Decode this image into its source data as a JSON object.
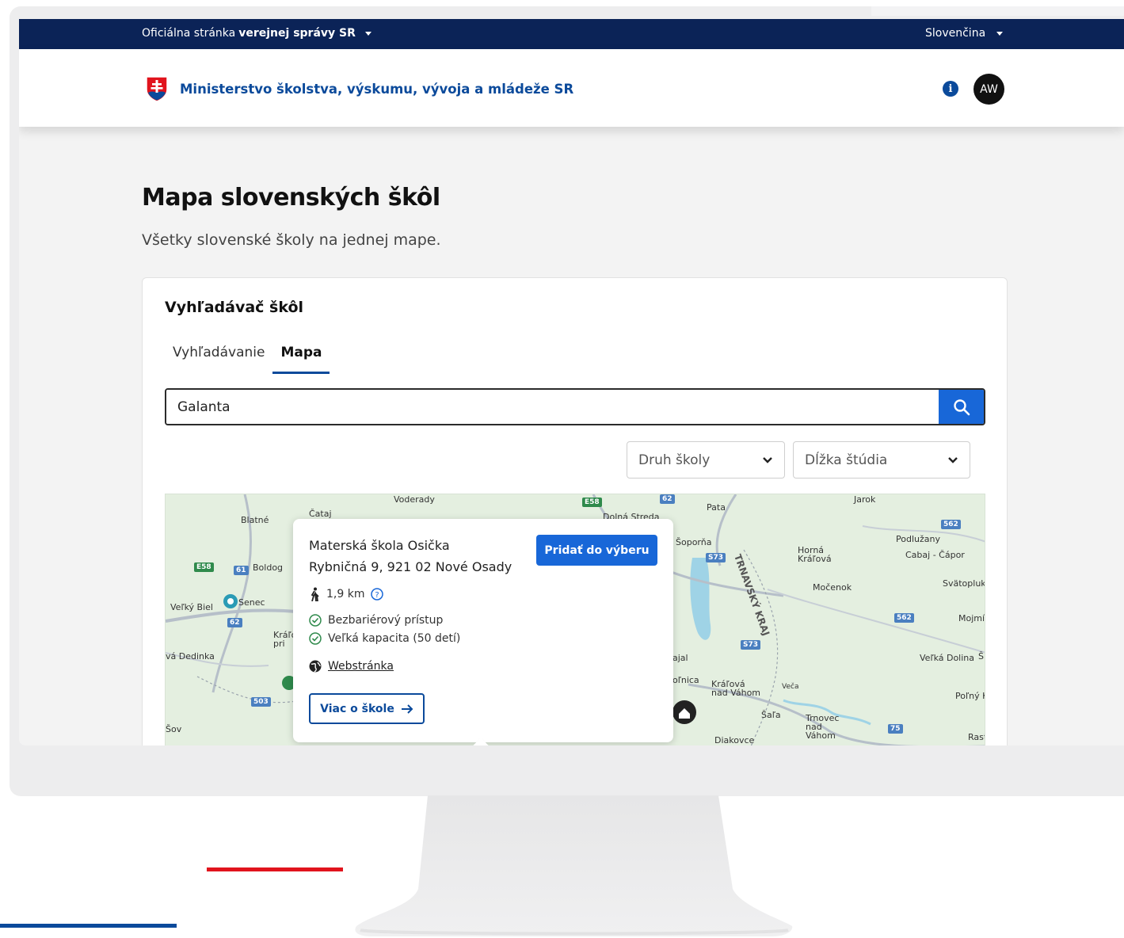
{
  "gov_bar": {
    "official_prefix": "Oficiálna stránka",
    "official_bold": "verejnej správy SR",
    "language": "Slovenčina"
  },
  "header": {
    "ministry": "Ministerstvo školstva, výskumu, vývoja a mládeže SR",
    "avatar_initials": "AW"
  },
  "page": {
    "title": "Mapa slovenských škôl",
    "subtitle": "Všetky slovenské školy na jednej mape."
  },
  "search_card": {
    "title": "Vyhľadávač škôl",
    "tabs": [
      {
        "label": "Vyhľadávanie",
        "active": false
      },
      {
        "label": "Mapa",
        "active": true
      }
    ],
    "search_value": "Galanta",
    "filters": [
      {
        "label": "Druh školy"
      },
      {
        "label": "Dĺžka štúdia"
      }
    ]
  },
  "map": {
    "labels": [
      "Voderady",
      "Čataj",
      "Blatné",
      "Dolná Streda",
      "Pata",
      "Jarok",
      "Boldog",
      "Podlužany",
      "Cabaj - Čápor",
      "Horná Kráľová",
      "Močenok",
      "Svätopluk",
      "Veľký Biel",
      "Senec",
      "Kráľová pri Senci",
      "Mojmír",
      "vá Dedinka",
      "Veľká Dolina",
      "Šoporňa",
      "Kráľová nad Váhom",
      "Veča",
      "Šaľa",
      "Trnovec nad Váhom",
      "Diakovce",
      "Poľný K",
      "Šov",
      "ajal",
      "oľnica",
      "TRNAVSKÝ KRAJ",
      "Rast",
      "Š"
    ],
    "road_numbers": [
      "E58",
      "61",
      "62",
      "503",
      "E58",
      "62",
      "S73",
      "S73",
      "562",
      "562",
      "75"
    ]
  },
  "popup": {
    "name": "Materská škola Osička",
    "address": "Rybničná 9, 921 02 Nové Osady",
    "add_button": "Pridať do výberu",
    "distance": "1,9 km",
    "features": [
      "Bezbariérový prístup",
      "Veľká kapacita (50 detí)"
    ],
    "website": "Webstránka",
    "more_button": "Viac o škole"
  },
  "colors": {
    "gov_bar": "#0b2357",
    "brand_blue": "#0b4a9b",
    "primary_button": "#1867d8",
    "success_green": "#2f8a4c",
    "map_bg": "#e4efe0"
  }
}
